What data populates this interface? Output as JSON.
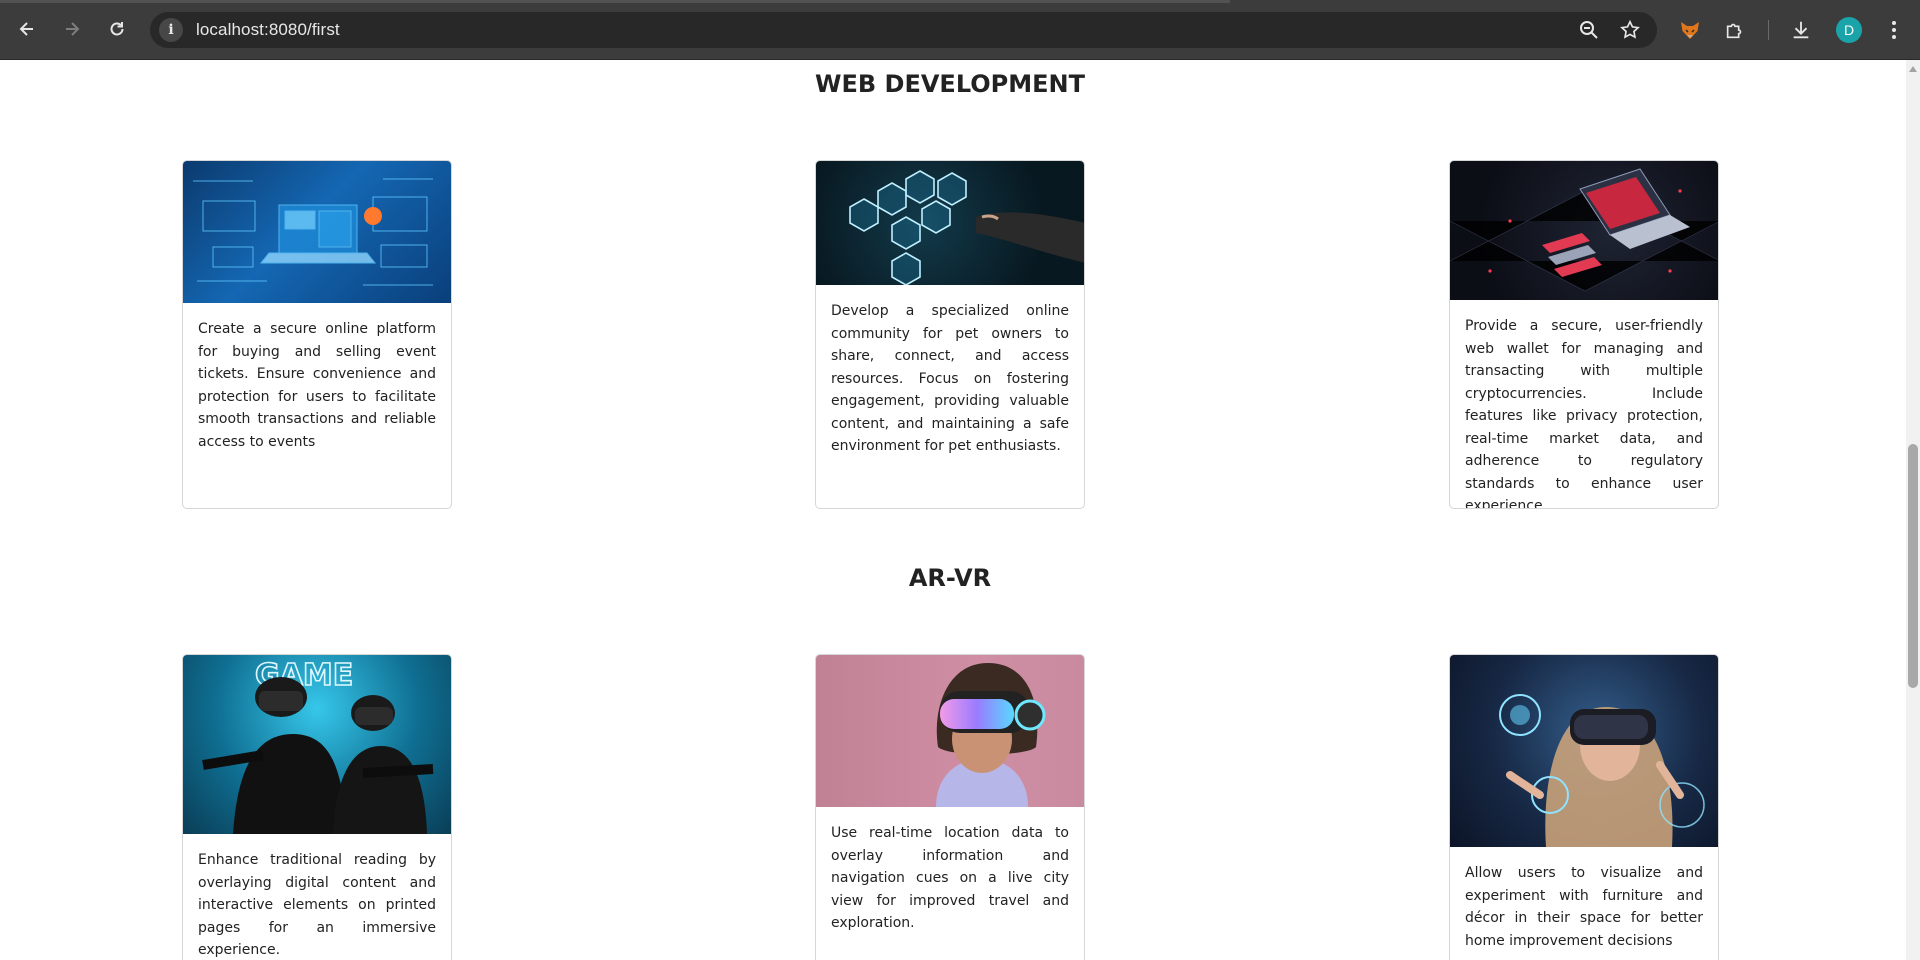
{
  "browser": {
    "url": "localhost:8080/first",
    "profile_initial": "D",
    "icons": {
      "back": "arrow-left-icon",
      "forward": "arrow-right-icon",
      "reload": "reload-icon",
      "site_info": "info-icon",
      "zoom": "zoom-out-icon",
      "bookmark": "star-icon",
      "extension_fox": "fox-extension-icon",
      "extensions": "puzzle-icon",
      "downloads": "download-icon",
      "menu": "kebab-menu-icon"
    }
  },
  "sections": [
    {
      "title": "WEB DEVELOPMENT",
      "cards": [
        {
          "image": "laptop-dashboard-image",
          "text": "Create a secure online platform for buying and selling event tickets. Ensure convenience and protection for users to facilitate smooth transactions and reliable access to events"
        },
        {
          "image": "hexagon-web-icons-image",
          "text": "Develop a specialized online community for pet owners to share, connect, and access resources. Focus on fostering engagement, providing valuable content, and maintaining a safe environment for pet enthusiasts."
        },
        {
          "image": "isometric-laptop-image",
          "text": "Provide a secure, user-friendly web wallet for managing and transacting with multiple cryptocurrencies. Include features like privacy protection, real-time market data, and adherence to regulatory standards to enhance user experience"
        }
      ]
    },
    {
      "title": "AR-VR",
      "cards": [
        {
          "image": "vr-gamers-image",
          "neon_sign": "GAME",
          "text": "Enhance traditional reading by overlaying digital content and interactive elements on printed pages for an immersive experience."
        },
        {
          "image": "vr-headset-woman-image",
          "text": "Use real-time location data to overlay information and navigation cues on a live city view for improved travel and exploration."
        },
        {
          "image": "vr-holographic-woman-image",
          "text": "Allow users to visualize and experiment with furniture and décor in their space for better home improvement decisions"
        }
      ]
    }
  ],
  "colors": {
    "chrome_bg": "#3c3c3c",
    "omnibox_bg": "#282828",
    "avatar_bg": "#1aa3a8",
    "heading_text": "#222222",
    "card_border": "#d6d6d6"
  }
}
